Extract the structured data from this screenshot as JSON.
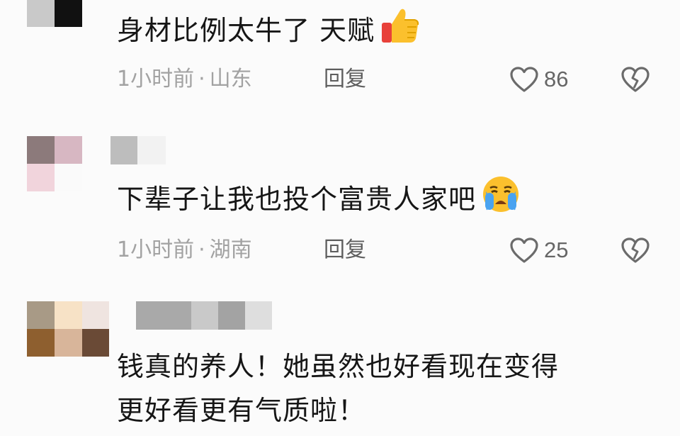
{
  "comments": [
    {
      "text": "身材比例太牛了 天赋",
      "emoji": "thumbs-up",
      "time": "1小时前",
      "location": "山东",
      "reply_label": "回复",
      "likes": "86"
    },
    {
      "text": "下辈子让我也投个富贵人家吧",
      "emoji": "crying-face",
      "time": "1小时前",
      "location": "湖南",
      "reply_label": "回复",
      "likes": "25"
    },
    {
      "text_line1": "钱真的养人！她虽然也好看现在变得",
      "text_line2": "更好看更有气质啦！"
    }
  ],
  "meta_separator": "·",
  "colors": {
    "text": "#161616",
    "meta": "#a2a2a2",
    "reply": "#5e5e5e",
    "icon": "#6b6b6b",
    "background": "#fbfbfb"
  }
}
